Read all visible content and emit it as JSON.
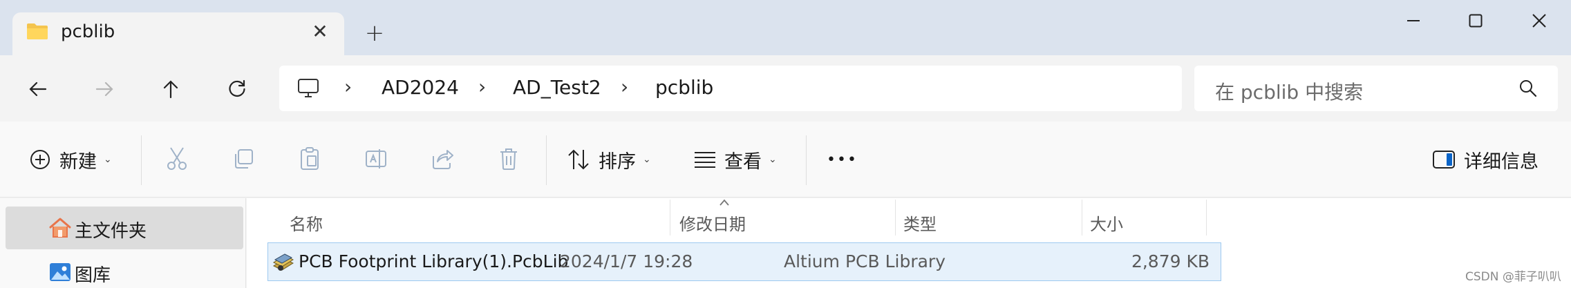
{
  "window": {
    "tab_title": "pcblib",
    "tab_close_glyph": "✕",
    "new_tab_glyph": "+"
  },
  "nav": {
    "breadcrumbs": [
      "AD2024",
      "AD_Test2",
      "pcblib"
    ],
    "separator": "›",
    "search_placeholder": "在 pcblib 中搜索"
  },
  "toolbar": {
    "new_label": "新建",
    "sort_label": "排序",
    "view_label": "查看",
    "more_label": "•••",
    "details_label": "详细信息"
  },
  "sidebar": {
    "items": [
      {
        "label": "主文件夹",
        "icon": "home-icon",
        "selected": true
      },
      {
        "label": "图库",
        "icon": "gallery-icon",
        "selected": false
      }
    ]
  },
  "table": {
    "columns": [
      "名称",
      "修改日期",
      "类型",
      "大小"
    ],
    "rows": [
      {
        "name": "PCB Footprint Library(1).PcbLib",
        "modified": "2024/1/7 19:28",
        "type": "Altium PCB Library",
        "size": "2,879 KB"
      }
    ]
  },
  "watermark": "CSDN @菲子叭叭",
  "colors": {
    "titlebar": "#dbe3ee",
    "accent": "#0a64c8",
    "selection": "#e6f1fb",
    "selection_border": "#9dc9f0"
  }
}
